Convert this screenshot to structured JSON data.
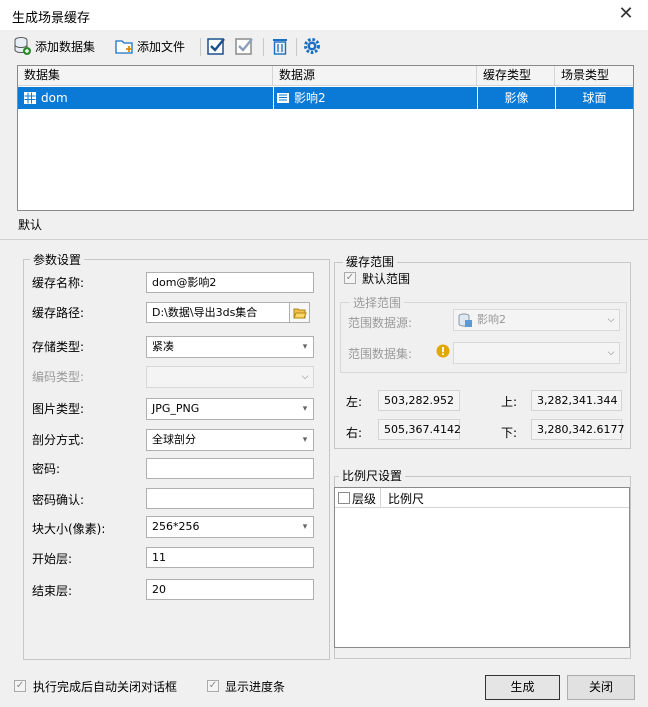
{
  "window": {
    "title": "生成场景缓存"
  },
  "toolbar": {
    "add_dataset": "添加数据集",
    "add_file": "添加文件"
  },
  "grid": {
    "headers": [
      "数据集",
      "数据源",
      "缓存类型",
      "场景类型"
    ],
    "rows": [
      {
        "dataset": "dom",
        "datasource": "影响2",
        "cache_type": "影像",
        "scene_type": "球面"
      }
    ]
  },
  "tabs": {
    "default": "默认"
  },
  "params": {
    "group_title": "参数设置",
    "cache_name_label": "缓存名称:",
    "cache_name_value": "dom@影响2",
    "cache_path_label": "缓存路径:",
    "cache_path_value": "D:\\数据\\导出3ds集合",
    "storage_type_label": "存储类型:",
    "storage_type_value": "紧凑",
    "encode_type_label": "编码类型:",
    "encode_type_value": "",
    "image_type_label": "图片类型:",
    "image_type_value": "JPG_PNG",
    "tiling_label": "剖分方式:",
    "tiling_value": "全球剖分",
    "password_label": "密码:",
    "password_confirm_label": "密码确认:",
    "tile_size_label": "块大小(像素):",
    "tile_size_value": "256*256",
    "start_level_label": "开始层:",
    "start_level_value": "11",
    "end_level_label": "结束层:",
    "end_level_value": "20"
  },
  "extent": {
    "group_title": "缓存范围",
    "default_extent_label": "默认范围",
    "select_title": "选择范围",
    "range_datasource_label": "范围数据源:",
    "range_datasource_value": "影响2",
    "range_dataset_label": "范围数据集:",
    "left_label": "左:",
    "left_value": "503,282.952",
    "top_label": "上:",
    "top_value": "3,282,341.344",
    "right_label": "右:",
    "right_value": "505,367.4142",
    "bottom_label": "下:",
    "bottom_value": "3,280,342.6177"
  },
  "scale": {
    "group_title": "比例尺设置",
    "col_level": "层级",
    "col_scale": "比例尺"
  },
  "footer": {
    "auto_close_label": "执行完成后自动关闭对话框",
    "show_progress_label": "显示进度条",
    "generate_button": "生成",
    "close_button": "关闭"
  },
  "colors": {
    "selection": "#0a7ad6",
    "icon_blue": "#1a6fc4",
    "warning": "#e0a800"
  }
}
